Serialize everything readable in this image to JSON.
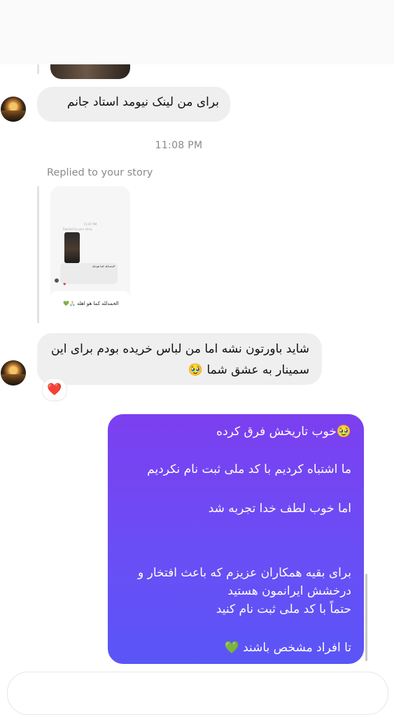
{
  "messages": {
    "m1": "برای من لینک نیومد استاد جانم",
    "timestamp": "11:08 PM",
    "replied_label": "Replied to your story",
    "story_preview": {
      "time": "11:07 PM",
      "replied": "Replied to your story",
      "caption": "الحمدلله کما هو اهله 🙏🏻💚",
      "bubble_text": "الحمدلله کما هوحله"
    },
    "m2": "شاید باورتون نشه اما من لباس خریده بودم برای این سمینار به عشق شما 🥹",
    "reaction": "❤️",
    "outgoing": {
      "line1": "🥹خوب تاریخش فرق کرده",
      "line2": "ما اشتباه کردیم با کد ملی  ثبت نام نکردیم",
      "line3": "اما خوب لطف خدا تجربه شد",
      "line4": "برای بقیه همکاران عزیزم که باعث افتخار و درخشش ایرانمون هستید\nحتماً با کد ملی ثبت نام کنید",
      "line5": "تا افراد مشخص باشند 💚"
    }
  },
  "colors": {
    "incoming_bubble": "#efefef",
    "outgoing_gradient_top": "#7c3ff0",
    "outgoing_gradient_bottom": "#5a55f7",
    "timestamp": "#8a8a8a"
  },
  "icons": {
    "avatar": "sunset-avatar",
    "reaction": "heart-icon"
  }
}
